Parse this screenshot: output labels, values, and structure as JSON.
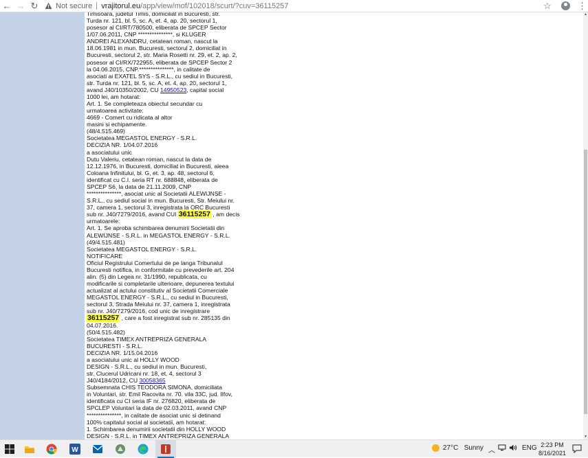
{
  "browser": {
    "security_label": "Not secure",
    "url_domain": "vrajitorul.eu",
    "url_path": "/app/view/mof/102018/scurt/?cuv=36115257",
    "icons": {
      "back": "back-arrow-icon",
      "forward": "forward-arrow-icon",
      "reload": "reload-icon",
      "warning": "warning-icon",
      "bookmark": "star-icon",
      "profile": "profile-icon",
      "menu": "kebab-menu-icon"
    }
  },
  "document": {
    "lines": [
      {
        "text": "Timisoara, judetul Timis, domiciliat in Bucuresti, str."
      },
      {
        "text": "Turda nr. 121, bl. 5, sc. A, et. 4, ap. 20, sectorul 1,"
      },
      {
        "text": "posesor al CI/RT/780500, eliberata de SPCEP Sector"
      },
      {
        "text": "1/07.06.2011, CNP ***************, si KLUGER"
      },
      {
        "text": "ANDREI ALEXANDRU, cetatean roman, nascut la"
      },
      {
        "text": "18.06.1981 in mun. Bucuresti, sectorul 2, domiciliat in"
      },
      {
        "text": "Bucuresti, sectorul 2, str. Maria Rosetti nr. 29, et. 2, ap. 2,"
      },
      {
        "text": "posesor al CI/RX/722955, eliberata de SPCEP Sector 2"
      },
      {
        "text": "la 04.06.2015, CNP.***************, in calitate de"
      },
      {
        "text": "asociati ai EXATEL SYS - S.R.L., cu sediul in Bucuresti,"
      },
      {
        "text": "str. Turda nr. 121, bl. 5, sc. A, et. 4, ap. 20, sectorul 1,"
      },
      {
        "text": "avand J40/10350/2002, CU ",
        "link": "14950523",
        "after": ", capital social"
      },
      {
        "text": "1000 lei, am hotarat:"
      },
      {
        "text": "Art. 1. Se completeaza obiectul secundar cu"
      },
      {
        "text": "urmatoarea activitate:"
      },
      {
        "text": "4669 - Comert cu ridicata al altor"
      },
      {
        "text": "masini si echipamente."
      },
      {
        "text": "(48/4.515.469)"
      },
      {
        "text": "Societatea MEGASTOL ENERGY - S.R.L."
      },
      {
        "text": "DECIZIA NR. 1/04.07.2016"
      },
      {
        "text": "a asociatului unic"
      },
      {
        "text": "Dutu Valeriu, cetatean roman, nascut la data de"
      },
      {
        "text": "12.12.1976, in Bucuresti, domiciliat in Bucuresti, aleea"
      },
      {
        "text": "Coloana Infinitului, bl. G, et. 3, ap. 48, sectorul 6,"
      },
      {
        "text": "identificat cu C.I. seria RT nr. 688848, eliberata de"
      },
      {
        "text": "SPCEP S6, la data de 21.11.2009, CNP"
      },
      {
        "text": "***************, asociat unic al Societatii ALEWIJNSE -"
      },
      {
        "text": "S.R.L., cu sediul social in mun. Bucuresti, Str. Meiului nr."
      },
      {
        "text": "37, camera 1, sectorul 3, inregistrata la ORC Bucuresti"
      },
      {
        "text": "sub nr. J40/7279/2016, avand CUI ",
        "highlight": "36115257",
        "after": " , am decis"
      },
      {
        "text": "urmatoarele:"
      },
      {
        "text": "Art. 1. Se aproba schimbarea denumirii Societatii din"
      },
      {
        "text": "ALEWIJNSE - S.R.L. in MEGASTOL ENERGY - S.R.L."
      },
      {
        "text": "(49/4.515.481)"
      },
      {
        "text": "Societatea MEGASTOL ENERGY - S.R.L."
      },
      {
        "text": "NOTIFICARE"
      },
      {
        "text": "Oficiul Registrului Comertului de pe langa Tribunalul"
      },
      {
        "text": "Bucuresti notifica, in conformitate cu prevederile art. 204"
      },
      {
        "text": "alin. (5) din Legea nr. 31/1990, republicata, cu"
      },
      {
        "text": "modificarile si completarile ulterioare, depunerea textului"
      },
      {
        "text": "actualizat al actului constitutiv al Societatii Comerciale"
      },
      {
        "text": "MEGASTOL ENERGY - S.R.L., cu sediul in Bucuresti,"
      },
      {
        "text": "sectorul 3, Strada Meiului nr. 37, camera 1, inregistrata"
      },
      {
        "text": "sub nr. J40/7279/2016, cod unic de inregistrare"
      },
      {
        "text": "",
        "highlight": "36115257",
        "after": " , care a fost inregistrat sub nr. 285135 din"
      },
      {
        "text": "04.07.2016."
      },
      {
        "text": "(50/4.515.482)"
      },
      {
        "text": "Societatea TIMEX ANTREPRIZA GENERALA"
      },
      {
        "text": "BUCURESTI - S.R.L."
      },
      {
        "text": "DECIZIA NR. 1/15.04.2016"
      },
      {
        "text": "a asociatului unic al HOLLY WOOD"
      },
      {
        "text": "DESIGN - S.R.L., cu sediul in mun. Bucuresti,"
      },
      {
        "text": "str. Clucerul Udricani nr. 18, et. 4, sectorul 3"
      },
      {
        "text": "J40/4184/2012, CU ",
        "link": "30058365"
      },
      {
        "text": "Subsemnata CHIS TEODORA SIMONA, domiciliata"
      },
      {
        "text": "in Voluntari, str. Emil Racovita nr. 70. vila 33C, jud. Ilfov,"
      },
      {
        "text": "identificata cu CI seria IF nr. 276820, eliberata de"
      },
      {
        "text": "SPCLEP Voluntari la data de 02.03.2011, avand CNP"
      },
      {
        "text": "***************, in calitate de asociat unic si detinand"
      },
      {
        "text": "100% capitalul social al societatii, am hotarat:"
      },
      {
        "text": "1. Schimbarea denumirii societatii din HOLLY WOOD"
      },
      {
        "text": "DESIGN - S.R.L. in TIMEX ANTREPRIZA GENERALA"
      },
      {
        "text": "BUCURESTI - S.R.L., conform dovezii privind"
      },
      {
        "text": "disponibilitatea si rezervarea firmei nr."
      },
      {
        "text": "175512/13.04.2016."
      }
    ]
  },
  "colors": {
    "left_panel": "#c3d3e5",
    "highlight": "#ffff3c",
    "link": "#1a0dab"
  },
  "taskbar": {
    "apps": [
      {
        "name": "windows-start-icon"
      },
      {
        "name": "file-explorer-icon"
      },
      {
        "name": "chrome-icon"
      },
      {
        "name": "word-icon"
      },
      {
        "name": "outlook-icon"
      },
      {
        "name": "app-icon"
      },
      {
        "name": "edge-icon"
      },
      {
        "name": "active-app-icon"
      }
    ],
    "weather_temp": "27°C",
    "weather_text": "Sunny",
    "language": "ENG",
    "time": "2:23 PM",
    "date": "8/16/2021"
  }
}
